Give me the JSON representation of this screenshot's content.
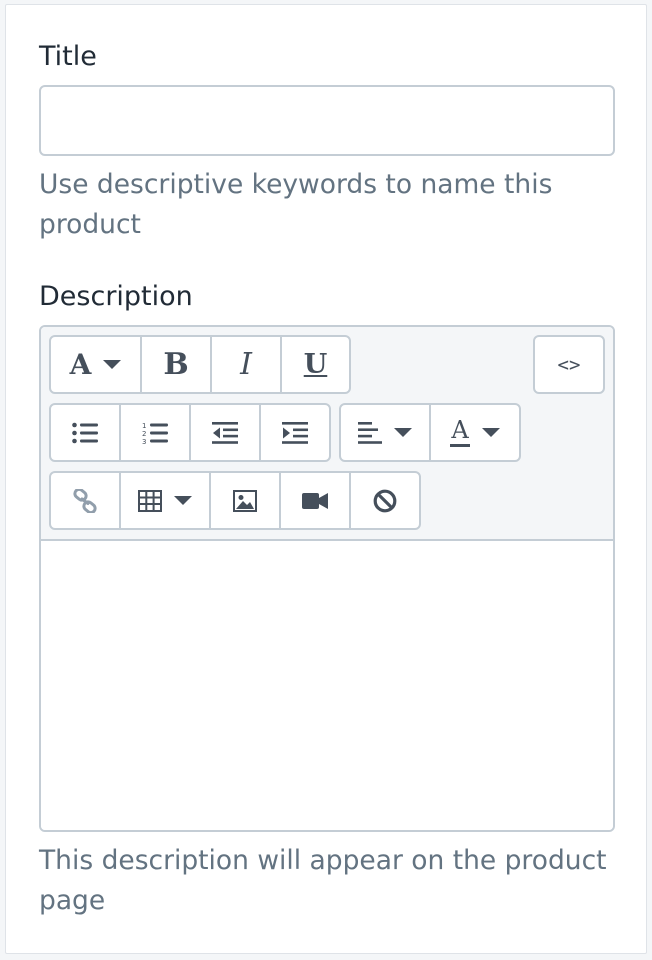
{
  "title_field": {
    "label": "Title",
    "value": "",
    "placeholder": "",
    "help_text": "Use descriptive keywords to name this product"
  },
  "description_field": {
    "label": "Description",
    "help_text": "This description will appear on the product page",
    "content": ""
  },
  "toolbar": {
    "font_glyph": "A",
    "bold_glyph": "B",
    "italic_glyph": "I",
    "underline_glyph": "U",
    "html_glyph": "<>",
    "text_color_glyph": "A"
  },
  "colors": {
    "text": "#212b36",
    "subdued": "#637381",
    "border": "#c4cdd5",
    "icon": "#454f5b",
    "toolbar_bg": "#f4f6f8"
  }
}
